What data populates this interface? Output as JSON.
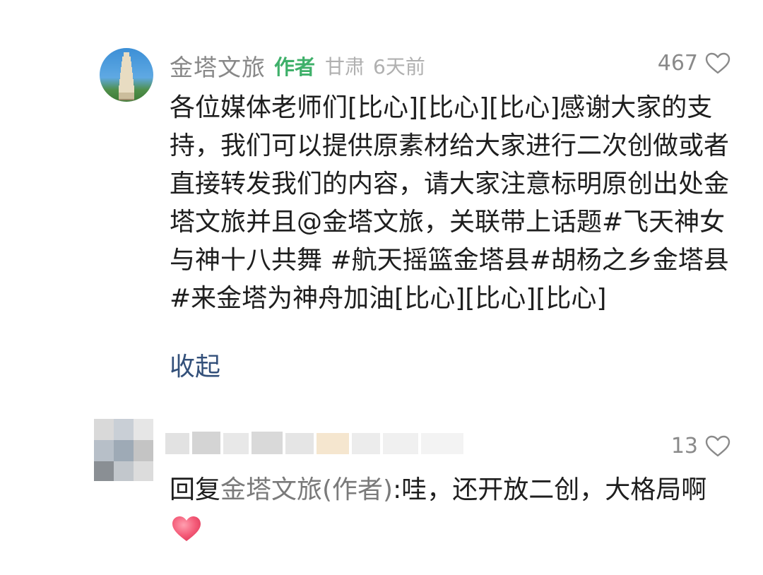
{
  "comment": {
    "username": "金塔文旅",
    "author_tag": "作者",
    "location": "甘肃",
    "time": "6天前",
    "like_count": "467",
    "body": "各位媒体老师们[比心][比心][比心]感谢大家的支持，我们可以提供原素材给大家进行二次创做或者直接转发我们的内容，请大家注意标明原创出处金塔文旅并且@金塔文旅，关联带上话题#飞天神女与神十八共舞   #航天摇篮金塔县#胡杨之乡金塔县#来金塔为神舟加油[比心][比心][比心]",
    "collapse_label": "收起"
  },
  "reply": {
    "like_count": "13",
    "prefix": "回复",
    "target": "金塔文旅(作者)",
    "text": ":哇，还开放二创，大格局啊"
  },
  "icons": {
    "like": "heart-outline-icon",
    "emoji": "heart-emoji-icon"
  },
  "colors": {
    "author_tag": "#3fb06a",
    "username": "#888888",
    "link": "#33507a",
    "heart_emoji": "#f0506e"
  }
}
